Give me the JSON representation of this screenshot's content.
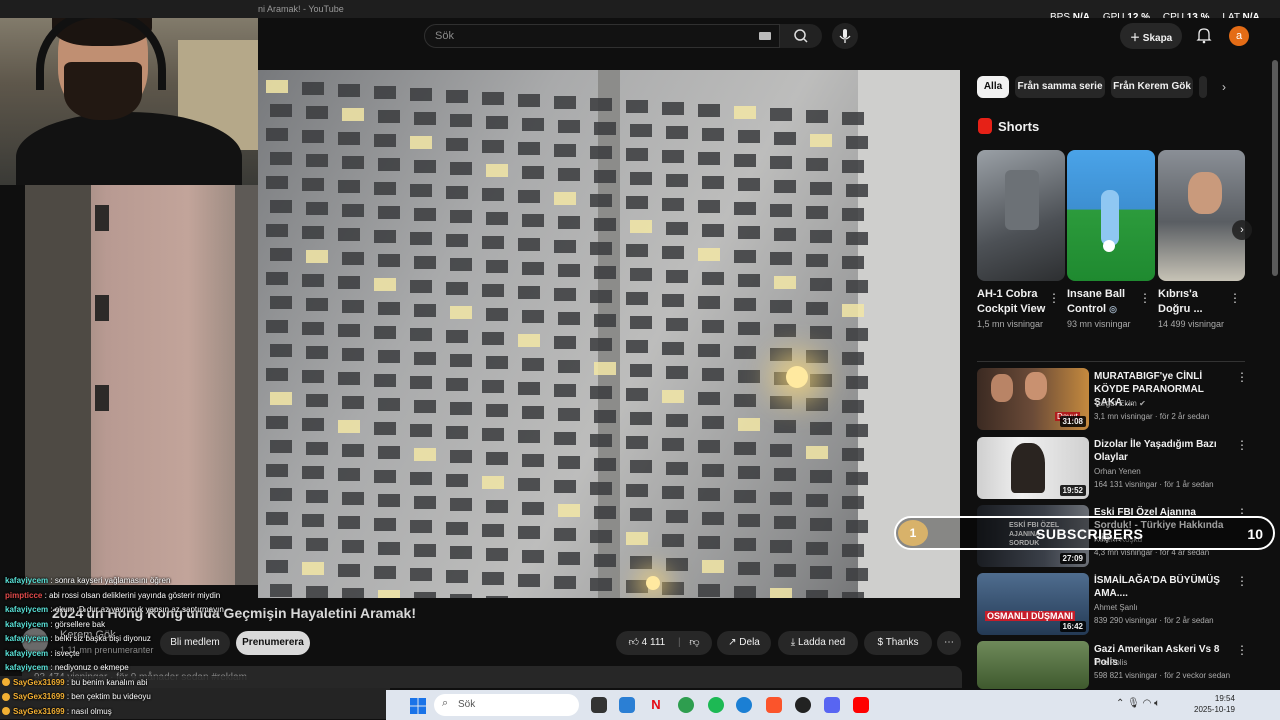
{
  "window": {
    "title": "ni Aramak! - YouTube"
  },
  "header": {
    "search_placeholder": "Sök",
    "create_label": "Skapa",
    "avatar_letter": "a"
  },
  "stats": {
    "bps_label": "BPS",
    "bps_value": "N/A",
    "gpu_label": "GPU",
    "gpu_value": "12 %",
    "cpu_label": "CPU",
    "cpu_value": "13 %",
    "lat_label": "LAT",
    "lat_value": "N/A"
  },
  "video": {
    "title": "2024'un Hong Kong'unda Geçmişin Hayaletini Aramak!",
    "channel_name": "Kerem Gök",
    "channel_subs": "1,11 mn prenumeranter",
    "join_label": "Bli medlem",
    "subscribe_label": "Prenumerera",
    "likes": "4 111",
    "share_label": "Dela",
    "download_label": "Ladda ned",
    "thanks_label": "Thanks",
    "description_preview": "93 474 visningar · för 9 månader sedan #reklam"
  },
  "chips": [
    "Alla",
    "Från samma serie",
    "Från Kerem Gök"
  ],
  "shorts": {
    "title": "Shorts",
    "items": [
      {
        "title": "AH-1 Cobra Cockpit View",
        "views": "1,5 mn visningar"
      },
      {
        "title": "Insane Ball Control",
        "views": "93 mn visningar"
      },
      {
        "title": "Kıbrıs'a Doğru ...",
        "views": "14 499 visningar"
      }
    ]
  },
  "recommendations": [
    {
      "title": "MURATABIGF'ye CİNLİ KÖYDE PARANORMAL ŞAKA ...",
      "channel": "Turgut Ekim",
      "meta": "3,1 mn visningar · för 2 år sedan",
      "duration": "31:08",
      "thumb_text": "Davut"
    },
    {
      "title": "Dizolar İle Yaşadığım Bazı Olaylar",
      "channel": "Orhan Yenen",
      "meta": "164 131 visningar · för 1 år sedan",
      "duration": "19:52",
      "thumb_text": ""
    },
    {
      "title": "Eski FBI Özel Ajanına Sorduk! - Türkiye Hakkında Hiç ...",
      "channel": "Kerem Köşkü",
      "meta": "4,3 mn visningar · för 4 år sedan",
      "duration": "27:09",
      "thumb_text": "ESKİ FBI ÖZEL AJANINA SORDUK"
    },
    {
      "title": "İSMAİLAĞA'DA BÜYÜMÜŞ AMA....",
      "channel": "Ahmet Şanlı",
      "meta": "839 290 visningar · för 2 år sedan",
      "duration": "16:42",
      "thumb_text": "OSMANLI DÜŞMANI"
    },
    {
      "title": "Gazi Amerikan Askeri Vs 8 Polis",
      "channel": "The Polis",
      "meta": "598 821 visningar · för 2 veckor sedan",
      "duration": "",
      "thumb_text": ""
    }
  ],
  "sub_goal": {
    "current": "1",
    "label": "SUBSCRIBERS",
    "target": "10"
  },
  "chat": [
    {
      "user": "kafayiycem",
      "color": "#59e1d7",
      "text": "sonra kayseri yağlamasını öğren"
    },
    {
      "user": "pimpticce",
      "color": "#e34b4b",
      "text": "abi rossi olsan deliklerini yayında gösterir miydin"
    },
    {
      "user": "kafayiycem",
      "color": "#59e1d7",
      "text": "okum :D dur az yavrucuk yapsın az saptırmayın"
    },
    {
      "user": "kafayiycem",
      "color": "#59e1d7",
      "text": "görsellere bak"
    },
    {
      "user": "kafayiycem",
      "color": "#59e1d7",
      "text": "belki siz başka bişi diyonuz"
    },
    {
      "user": "kafayiycem",
      "color": "#59e1d7",
      "text": "isveçte"
    },
    {
      "user": "kafayiycem",
      "color": "#59e1d7",
      "text": "nediyonuz o ekmepe"
    },
    {
      "user": "SayGex31699",
      "color": "#f3b033",
      "text": "bu benim kanalım abi"
    },
    {
      "user": "SayGex31699",
      "color": "#f3b033",
      "text": "ben çektim bu videoyu"
    },
    {
      "user": "SayGex31699",
      "color": "#f3b033",
      "text": "nasıl olmuş"
    }
  ],
  "taskbar": {
    "search_placeholder": "Sök",
    "time": "19:54",
    "date": "2025-10-19",
    "colors": {
      "chrome": "#2e9e4f",
      "netflix": "#e50914",
      "spotify": "#1db954",
      "edge": "#1b7fd4",
      "brave": "#fb542b",
      "discord": "#5865f2",
      "youtube": "#ff0000"
    }
  }
}
